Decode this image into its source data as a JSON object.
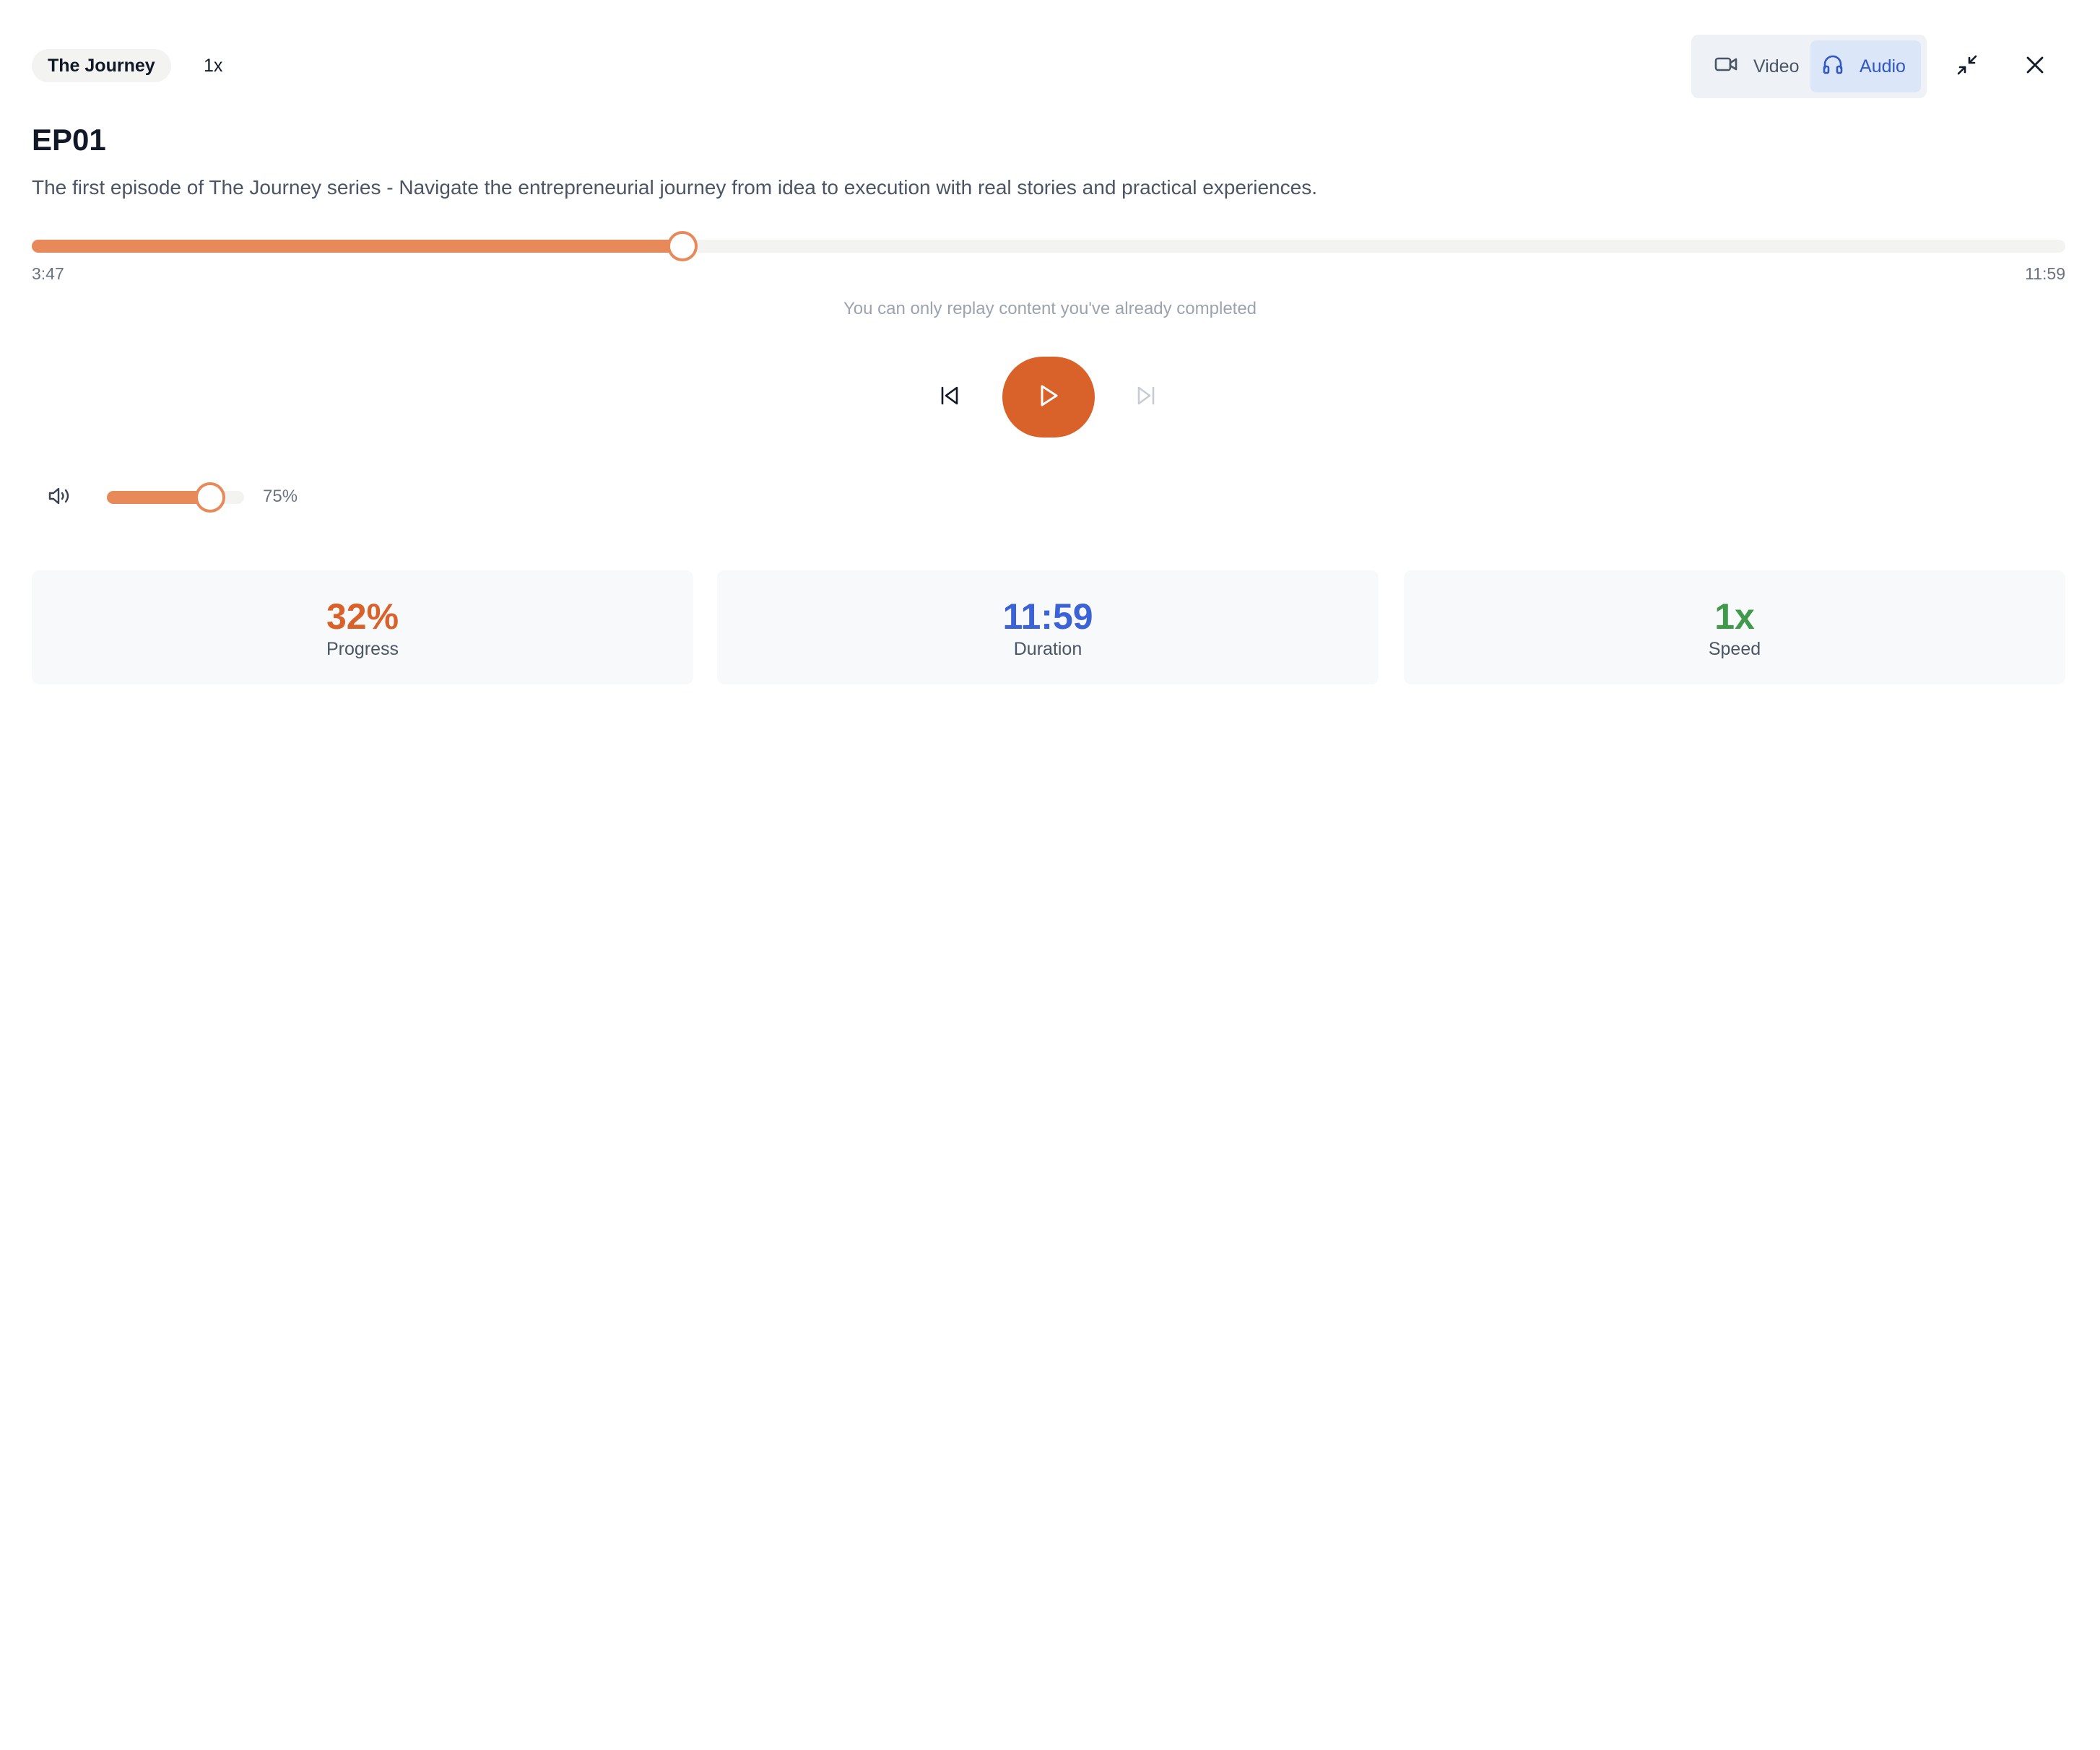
{
  "header": {
    "series_name": "The Journey",
    "speed_label": "1x",
    "modes": {
      "video_label": "Video",
      "audio_label": "Audio",
      "selected": "audio"
    }
  },
  "episode": {
    "title": "EP01",
    "description": "The first episode of The Journey series - Navigate the entrepreneurial journey from idea to execution with real stories and practical experiences."
  },
  "playback": {
    "current_time": "3:47",
    "total_time": "11:59",
    "progress_fraction": 0.32,
    "replay_note": "You can only replay content you've already completed",
    "state": "paused"
  },
  "volume": {
    "value_label": "75%",
    "fraction": 0.75
  },
  "stats": [
    {
      "value": "32%",
      "label": "Progress",
      "color": "#d9622b"
    },
    {
      "value": "11:59",
      "label": "Duration",
      "color": "#3b63d6"
    },
    {
      "value": "1x",
      "label": "Speed",
      "color": "#3f9a4c"
    }
  ],
  "colors": {
    "accent": "#d9622b",
    "slider_fill": "#e8895a",
    "audio_active": "#2f58c4"
  },
  "icons": {
    "video": "video-camera-icon",
    "audio": "headphones-icon",
    "minimize": "minimize-icon",
    "close": "close-icon",
    "previous": "skip-back-icon",
    "play": "play-icon",
    "next": "skip-forward-icon",
    "volume": "volume-icon"
  }
}
